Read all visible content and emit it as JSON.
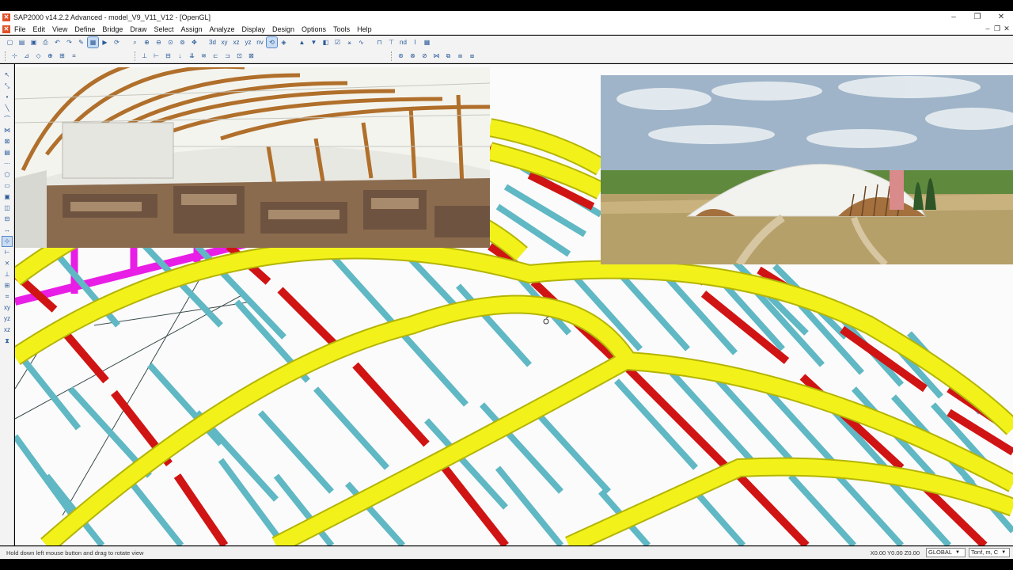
{
  "window": {
    "title": "SAP2000 v14.2.2 Advanced  - model_V9_V11_V12 - [OpenGL]",
    "minimize_glyph": "–",
    "restore_glyph": "❐",
    "close_glyph": "✕"
  },
  "menu": {
    "items": [
      "File",
      "Edit",
      "View",
      "Define",
      "Bridge",
      "Draw",
      "Select",
      "Assign",
      "Analyze",
      "Display",
      "Design",
      "Options",
      "Tools",
      "Help"
    ]
  },
  "toolbar": {
    "view_3d_label": "3d",
    "view_xy_label": "xy",
    "view_xz_label": "xz",
    "view_yz_label": "yz",
    "view_nv_label": "nv",
    "nd_label": "nd"
  },
  "status": {
    "message": "Hold down left mouse button and drag to rotate view",
    "coordinates": "X0.00  Y0.00  Z0.00",
    "coord_system": "GLOBAL",
    "units": "Tonf, m, C"
  },
  "colors": {
    "arch_yellow": "#f2f21a",
    "purlin_cyan": "#5fb8c4",
    "purlin_red": "#d01414",
    "bracing_magenta": "#e81ee6"
  },
  "icons": {
    "app": "sap2000-logo-icon",
    "cursor": "rotate-cursor-icon"
  }
}
